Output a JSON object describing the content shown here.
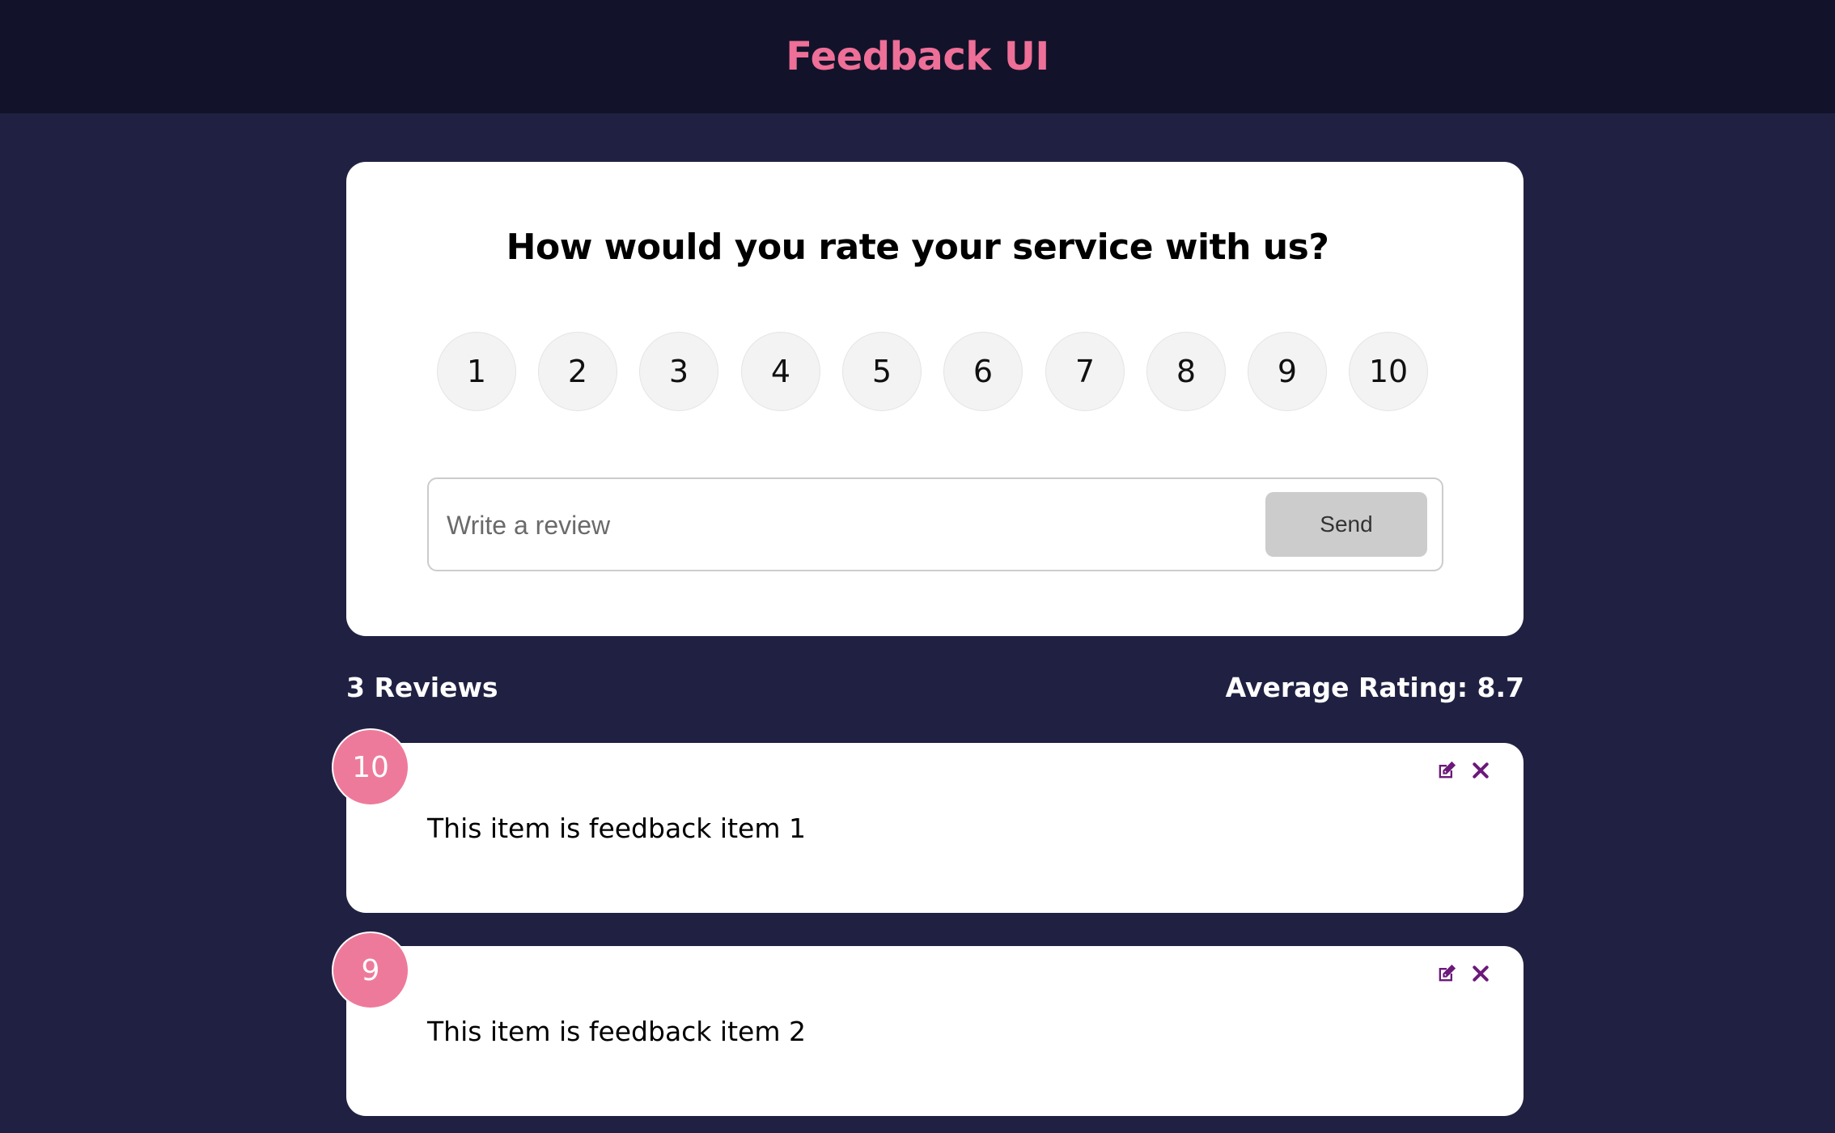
{
  "header": {
    "title": "Feedback UI"
  },
  "rate_card": {
    "question": "How would you rate your service with us?",
    "ratings": [
      "1",
      "2",
      "3",
      "4",
      "5",
      "6",
      "7",
      "8",
      "9",
      "10"
    ],
    "review_placeholder": "Write a review",
    "review_value": "",
    "send_label": "Send"
  },
  "stats": {
    "count_label": "3 Reviews",
    "average_label": "Average Rating: 8.7"
  },
  "feedback_items": [
    {
      "rating": "10",
      "text": "This item is feedback item 1"
    },
    {
      "rating": "9",
      "text": "This item is feedback item 2"
    }
  ],
  "icons": {
    "edit": "edit-icon",
    "close": "close-icon"
  },
  "colors": {
    "background": "#202142",
    "header_background": "#12132a",
    "brand": "#ee6f97",
    "badge": "#ee7a9b",
    "icon": "#6b1a7a",
    "card": "#ffffff"
  }
}
